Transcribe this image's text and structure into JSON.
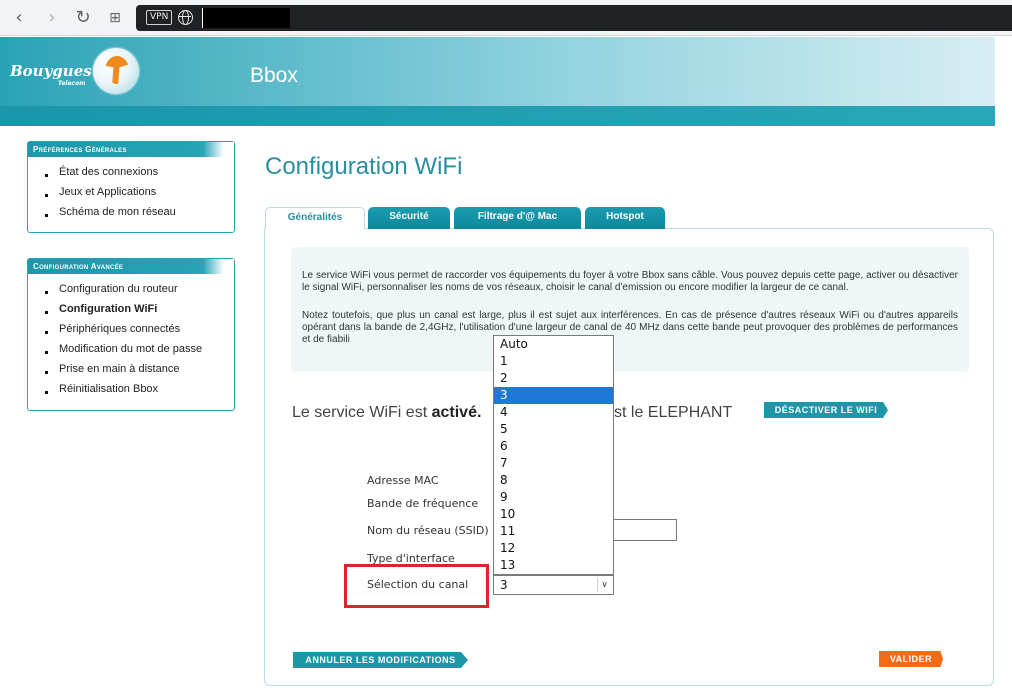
{
  "browser": {
    "back_icon": "chevron-left-icon",
    "forward_icon": "chevron-right-icon",
    "reload_icon": "reload-icon",
    "grid_icon": "grid-icon",
    "vpn_label": "VPN"
  },
  "header": {
    "logo_text": "Bouygues",
    "logo_sub": "Telecom",
    "title": "Bbox"
  },
  "sidebar": {
    "general": {
      "heading": "Préférences Générales",
      "items": [
        "État des connexions",
        "Jeux et Applications",
        "Schéma de mon réseau"
      ]
    },
    "advanced": {
      "heading": "Configuration Avancée",
      "items": [
        "Configuration du routeur",
        "Configuration WiFi",
        "Périphériques connectés",
        "Modification du mot de passe",
        "Prise en main à distance",
        "Réinitialisation Bbox"
      ],
      "active_index": 1
    }
  },
  "main": {
    "title": "Configuration WiFi",
    "tabs": [
      "Généralités",
      "Sécurité",
      "Filtrage d'@ Mac",
      "Hotspot"
    ],
    "info_p1": "Le service WiFi vous permet de raccorder vos équipements du foyer à votre Bbox sans câble. Vous pouvez depuis cette page, activer ou désactiver le signal WiFi, personnaliser les noms de vos réseaux, choisir le canal d'emission ou encore modifier la largeur de ce canal.",
    "info_p2": "Notez toutefois, que plus un canal est large, plus il est sujet aux interférences. En cas de présence d'autres réseaux WiFi ou d'autres appareils opérant dans la bande de 2,4GHz, l'utilisation d'une largeur de canal de 40 MHz dans cette bande peut provoquer des problèmes de performances et de fiabili",
    "status_prefix": "Le service WiFi est ",
    "status_state": "activé.",
    "status_suffix": "st le ELEPHANT",
    "deactivate_button": "DÉSACTIVER LE WIFI",
    "fields": {
      "mac": "Adresse MAC",
      "band": "Bande de fréquence",
      "ssid": "Nom du réseau (SSID)",
      "interface": "Type d'interface",
      "channel": "Sélection du canal"
    },
    "channel": {
      "selected": "3",
      "options": [
        "Auto",
        "1",
        "2",
        "3",
        "4",
        "5",
        "6",
        "7",
        "8",
        "9",
        "10",
        "11",
        "12",
        "13"
      ]
    },
    "cancel_button": "ANNULER LES MODIFICATIONS",
    "validate_button": "VALIDER"
  },
  "colors": {
    "brand_teal": "#1d96a8",
    "accent_orange": "#f36b13",
    "highlight_red": "#d9262c",
    "selection_blue": "#1e78d6"
  }
}
